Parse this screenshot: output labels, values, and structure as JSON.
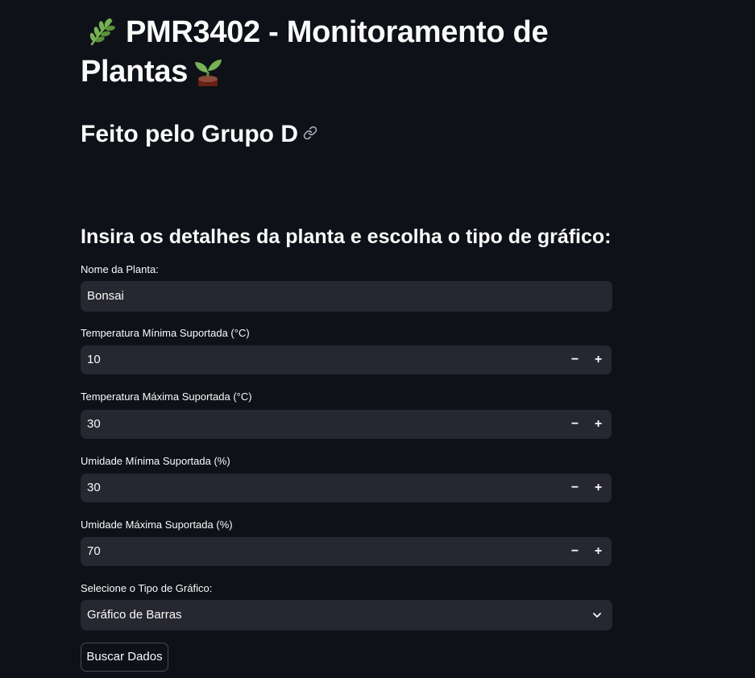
{
  "page": {
    "title_line1": "PMR3402 - Monitoramento de",
    "title_line2": "Plantas",
    "title_icons": [
      "herb-icon",
      "seedling-icon"
    ],
    "subtitle": "Feito pelo Grupo D",
    "section_heading": "Insira os detalhes da planta e escolha o tipo de gráfico:"
  },
  "form": {
    "plant_name": {
      "label": "Nome da Planta:",
      "value": "Bonsai"
    },
    "temp_min": {
      "label": "Temperatura Mínima Suportada (°C)",
      "value": "10"
    },
    "temp_max": {
      "label": "Temperatura Máxima Suportada (°C)",
      "value": "30"
    },
    "humidity_min": {
      "label": "Umidade Mínima Suportada (%)",
      "value": "30"
    },
    "humidity_max": {
      "label": "Umidade Máxima Suportada (%)",
      "value": "70"
    },
    "chart_type": {
      "label": "Selecione o Tipo de Gráfico:",
      "selected": "Gráfico de Barras"
    },
    "stepper": {
      "minus": "−",
      "plus": "+"
    },
    "submit_label": "Buscar Dados"
  },
  "colors": {
    "background": "#0e1117",
    "input_background": "#262730",
    "text": "#fafafa"
  }
}
